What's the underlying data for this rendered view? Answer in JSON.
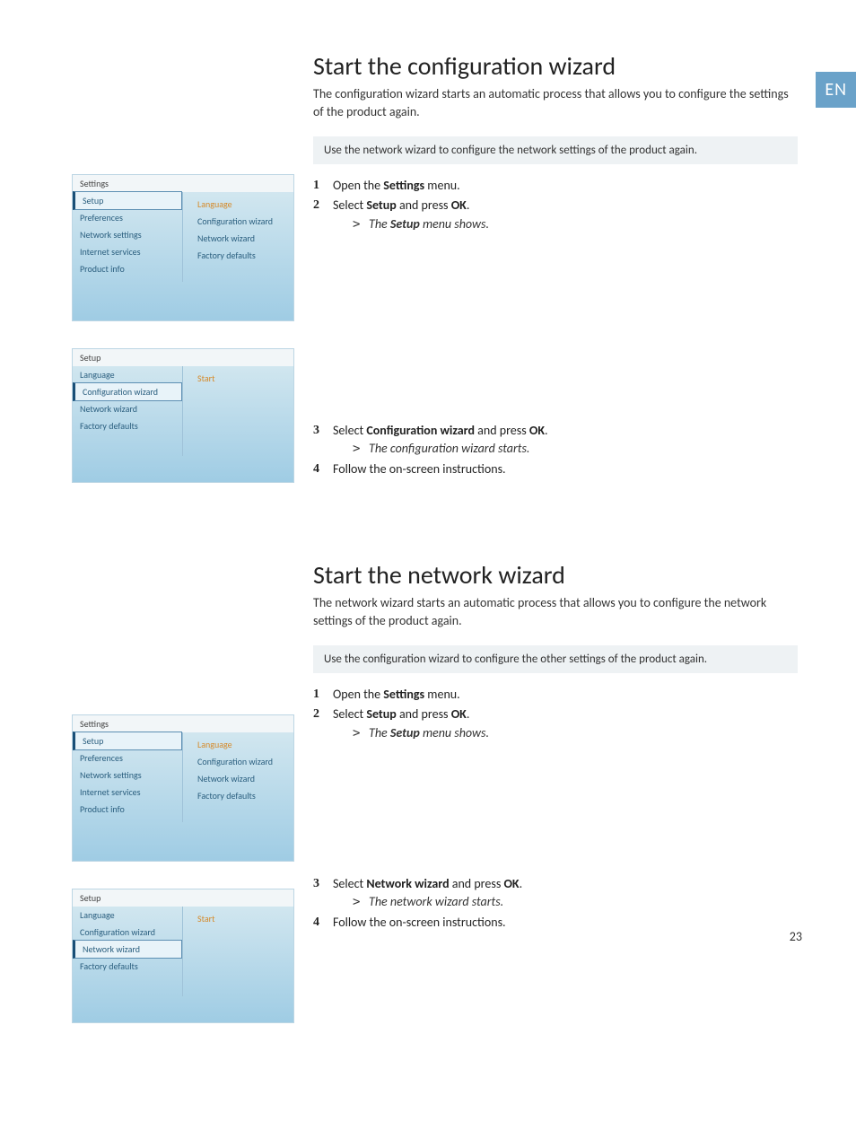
{
  "langTab": "EN",
  "pageNumber": "23",
  "sectionA": {
    "heading": "Start the configuration wizard",
    "lead": "The configuration wizard starts an automatic process that allows you to configure the settings of the product again.",
    "note": "Use the network wizard to configure the network settings of the product again.",
    "step1_pre": "Open the ",
    "step1_b": "Settings",
    "step1_post": " menu.",
    "step2_pre": "Select ",
    "step2_b1": "Setup",
    "step2_mid": " and press ",
    "step2_b2": "OK",
    "step2_post": ".",
    "step2_res_pre": "The ",
    "step2_res_b": "Setup",
    "step2_res_post": " menu shows.",
    "step3_pre": "Select ",
    "step3_b1": "Configuration wizard",
    "step3_mid": " and press ",
    "step3_b2": "OK",
    "step3_post": ".",
    "step3_res": "The configuration wizard starts.",
    "step4": "Follow the on-screen instructions."
  },
  "sectionB": {
    "heading": "Start the network wizard",
    "lead": "The network wizard starts an automatic process that allows you to configure the network settings of the product again.",
    "note": "Use the configuration wizard to configure the other settings of the product again.",
    "step1_pre": "Open the ",
    "step1_b": "Settings",
    "step1_post": " menu.",
    "step2_pre": "Select ",
    "step2_b1": "Setup",
    "step2_mid": " and press ",
    "step2_b2": "OK",
    "step2_post": ".",
    "step2_res_pre": "The ",
    "step2_res_b": "Setup",
    "step2_res_post": " menu shows.",
    "step3_pre": "Select ",
    "step3_b1": "Network wizard",
    "step3_mid": " and press ",
    "step3_b2": "OK",
    "step3_post": ".",
    "step3_res": "The network wizard starts.",
    "step4": "Follow the on-screen instructions."
  },
  "menu": {
    "settings": {
      "header": "Settings",
      "left": [
        "Setup",
        "Preferences",
        "Network settings",
        "Internet services",
        "Product info"
      ],
      "right": [
        "Language",
        "Configuration wizard",
        "Network wizard",
        "Factory defaults"
      ]
    },
    "setupConfig": {
      "header": "Setup",
      "left": [
        "Language",
        "Configuration wizard",
        "Network wizard",
        "Factory defaults"
      ],
      "right": "Start"
    },
    "setupNet": {
      "header": "Setup",
      "left": [
        "Language",
        "Configuration wizard",
        "Network wizard",
        "Factory defaults"
      ],
      "right": "Start"
    }
  }
}
